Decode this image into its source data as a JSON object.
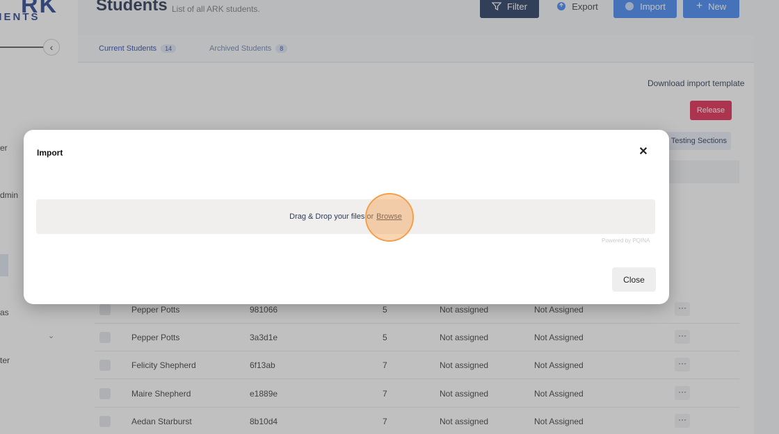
{
  "logo": {
    "big": "RK",
    "small": "MENTS"
  },
  "sidebar": {
    "collapse_icon": "‹",
    "items": [
      {
        "label": "er"
      },
      {
        "label": "dmin"
      },
      {
        "label": "as"
      },
      {
        "label": "ter"
      }
    ],
    "chevron": "⌄"
  },
  "header": {
    "title": "Students",
    "subtitle": "List of all ARK students.",
    "filter_label": "Filter",
    "export_label": "Export",
    "import_label": "Import",
    "new_label": "New"
  },
  "tabs": [
    {
      "label": "Current Students",
      "count": "14"
    },
    {
      "label": "Archived Students",
      "count": "8"
    }
  ],
  "actions": {
    "download_template": "Download import template",
    "release": "Release",
    "testing_sections": "o Testing Sections"
  },
  "table": {
    "more_label": "···",
    "rows": [
      {
        "name": "Pepper Potts",
        "code": "981066",
        "grade": "5",
        "status1": "Not assigned",
        "status2": "Not Assigned"
      },
      {
        "name": "Pepper Potts",
        "code": "3a3d1e",
        "grade": "5",
        "status1": "Not assigned",
        "status2": "Not Assigned"
      },
      {
        "name": "Felicity Shepherd",
        "code": "6f13ab",
        "grade": "7",
        "status1": "Not assigned",
        "status2": "Not Assigned"
      },
      {
        "name": "Maire Shepherd",
        "code": "e1889e",
        "grade": "7",
        "status1": "Not assigned",
        "status2": "Not Assigned"
      },
      {
        "name": "Aedan Starburst",
        "code": "8b10d4",
        "grade": "7",
        "status1": "Not assigned",
        "status2": "Not Assigned"
      }
    ]
  },
  "modal": {
    "title": "Import",
    "close_icon": "✕",
    "dropzone_text": "Drag & Drop your files or",
    "browse_label": "Browse",
    "powered_by": "Powered by PQINA",
    "close_label": "Close"
  },
  "colors": {
    "accent": "#3b82f6",
    "navy": "#1a2f5a",
    "release": "#e11d48",
    "click_highlight": "#f2a04e"
  }
}
